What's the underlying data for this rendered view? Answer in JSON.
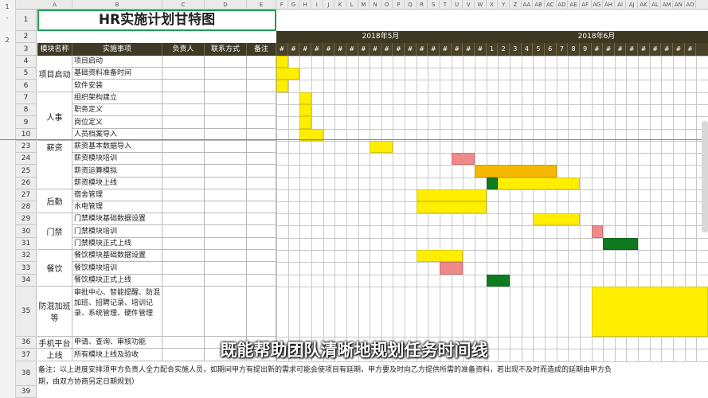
{
  "title": "HR实施计划甘特图",
  "columns": {
    "module": "模块名称",
    "task": "实施事项",
    "owner": "负责人",
    "contact": "联系方式",
    "remark": "备注"
  },
  "col_letters": [
    "A",
    "B",
    "C",
    "D",
    "E",
    "F",
    "G",
    "H",
    "I",
    "J",
    "K",
    "L",
    "M",
    "N",
    "O",
    "P",
    "Q",
    "R",
    "S",
    "T",
    "U",
    "V",
    "W",
    "X",
    "Y",
    "Z",
    "AA",
    "AB",
    "AC",
    "AD",
    "AE",
    "AF",
    "AG",
    "AH",
    "AI",
    "AJ",
    "AK",
    "AL",
    "AM",
    "AN",
    "AO"
  ],
  "months": [
    "2018年5月",
    "2018年6月"
  ],
  "may_days": [
    "#",
    "#",
    "#",
    "#",
    "#",
    "#",
    "#",
    "#",
    "#",
    "#",
    "#",
    "#",
    "#",
    "#",
    "#",
    "#",
    "#",
    "#"
  ],
  "june_days": [
    "1",
    "2",
    "3",
    "4",
    "5",
    "6",
    "7",
    "8",
    "9",
    "#",
    "#",
    "#",
    "#",
    "#",
    "#",
    "#",
    "#",
    "#"
  ],
  "rows": [
    {
      "n": "1"
    },
    {
      "n": "2"
    },
    {
      "n": "3"
    },
    {
      "n": "4",
      "task": "项目启动"
    },
    {
      "n": "5",
      "task": "基础资料准备时间"
    },
    {
      "n": "6",
      "task": "软件安装"
    },
    {
      "n": "7",
      "task": "组织架构建立"
    },
    {
      "n": "8",
      "task": "职务定义"
    },
    {
      "n": "9",
      "task": "岗位定义"
    },
    {
      "n": "10",
      "task": "人员档案导入"
    },
    {
      "n": "23",
      "task": "薪资基本数据导入"
    },
    {
      "n": "24",
      "task": "薪资模块培训"
    },
    {
      "n": "25",
      "task": "薪资运算模拟"
    },
    {
      "n": "26",
      "task": "薪资模块上线"
    },
    {
      "n": "27",
      "task": "宿舍管理"
    },
    {
      "n": "28",
      "task": "水电管理"
    },
    {
      "n": "29",
      "task": "门禁模块基础数据设置"
    },
    {
      "n": "30",
      "task": "门禁模块培训"
    },
    {
      "n": "31",
      "task": "门禁模块正式上线"
    },
    {
      "n": "32",
      "task": "餐饮模块基础数据设置"
    },
    {
      "n": "33",
      "task": "餐饮模块培训"
    },
    {
      "n": "34",
      "task": "餐饮模块正式上线"
    },
    {
      "n": "35",
      "task": "审批中心、智能提醒、防混加班、招聘记录、培训记录、系统管理、硬件管理"
    },
    {
      "n": "36",
      "task": "申请、查询、审核功能"
    },
    {
      "n": "37",
      "task": "所有模块上线及验收"
    },
    {
      "n": "38"
    },
    {
      "n": "39"
    }
  ],
  "categories": {
    "project": "项目启动",
    "hr": "人事",
    "salary": "薪资",
    "logistics": "后勤",
    "access": "门禁",
    "dining": "餐饮",
    "anti": "防混加班等",
    "mobile": "手机平台",
    "online": "上线"
  },
  "note": "备注：以上进度安排须甲方负责人全力配合实施人员，如期间甲方有提出新的需求可能会使项目有延期，甲方要及时向乙方提供所需的准备资料，若出现不及时而造成的延期由甲方负",
  "note2": "期，由双方协商另定日期规划）",
  "subtitle": "既能帮助团队清晰地规划任务时间线",
  "bar_colors": {
    "plan": "#ffee00",
    "delay": "#ee8a8a",
    "orange": "#f5b800",
    "done": "#0f7a1f"
  },
  "gantt": [
    {
      "row": 3,
      "start": 0,
      "len": 1,
      "color": "plan"
    },
    {
      "row": 4,
      "start": 0,
      "len": 2,
      "color": "plan"
    },
    {
      "row": 5,
      "start": 0,
      "len": 1,
      "color": "plan"
    },
    {
      "row": 6,
      "start": 2,
      "len": 1,
      "color": "plan"
    },
    {
      "row": 7,
      "start": 2,
      "len": 1,
      "color": "plan"
    },
    {
      "row": 8,
      "start": 2,
      "len": 1,
      "color": "plan"
    },
    {
      "row": 9,
      "start": 2,
      "len": 2,
      "color": "plan"
    },
    {
      "row": 10,
      "start": 8,
      "len": 2,
      "color": "plan"
    },
    {
      "row": 11,
      "start": 15,
      "len": 2,
      "color": "delay"
    },
    {
      "row": 12,
      "start": 17,
      "len": 7,
      "color": "orange"
    },
    {
      "row": 13,
      "start": 18,
      "len": 1,
      "color": "done"
    },
    {
      "row": 13,
      "start": 19,
      "len": 7,
      "color": "plan"
    },
    {
      "row": 14,
      "start": 12,
      "len": 6,
      "color": "plan"
    },
    {
      "row": 15,
      "start": 12,
      "len": 6,
      "color": "plan"
    },
    {
      "row": 16,
      "start": 22,
      "len": 4,
      "color": "plan"
    },
    {
      "row": 17,
      "start": 27,
      "len": 1,
      "color": "delay"
    },
    {
      "row": 18,
      "start": 28,
      "len": 3,
      "color": "done"
    },
    {
      "row": 19,
      "start": 12,
      "len": 4,
      "color": "plan"
    },
    {
      "row": 20,
      "start": 14,
      "len": 2,
      "color": "delay"
    },
    {
      "row": 21,
      "start": 18,
      "len": 2,
      "color": "done"
    },
    {
      "row": 22,
      "start": 27,
      "len": 10,
      "color": "plan"
    }
  ]
}
